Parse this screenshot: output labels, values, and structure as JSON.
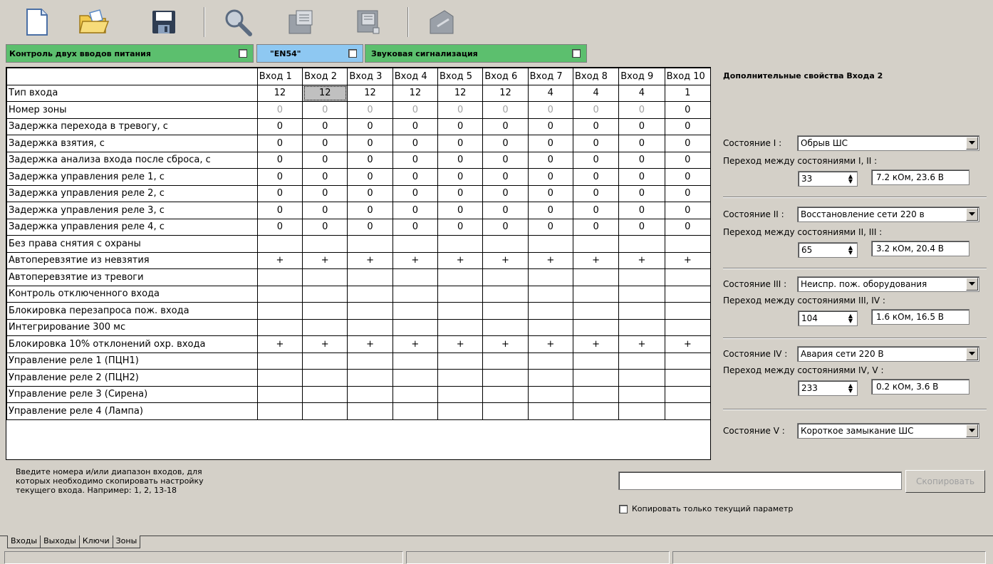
{
  "toolbar": {
    "buttons": [
      {
        "icon": "new-document-icon"
      },
      {
        "icon": "open-folder-icon"
      },
      {
        "icon": "save-icon"
      },
      {
        "icon": "search-icon"
      },
      {
        "icon": "read-device-icon"
      },
      {
        "icon": "write-device-icon"
      },
      {
        "icon": "firmware-icon"
      }
    ]
  },
  "flags": {
    "dual_power": "Контроль двух вводов питания",
    "en54": "\"EN54\"",
    "sound": "Звуковая сигнализация",
    "colors": {
      "dual_power": "#5cbf6e",
      "en54": "#8ec8f2",
      "sound": "#5cbf6e"
    }
  },
  "grid": {
    "columns": [
      "Вход 1",
      "Вход 2",
      "Вход 3",
      "Вход 4",
      "Вход 5",
      "Вход 6",
      "Вход 7",
      "Вход 8",
      "Вход 9",
      "Вход 10"
    ],
    "rows": [
      {
        "label": "Тип входа",
        "values": [
          "12",
          "12",
          "12",
          "12",
          "12",
          "12",
          "4",
          "4",
          "4",
          "1"
        ]
      },
      {
        "label": "Номер зоны",
        "values": [
          "0",
          "0",
          "0",
          "0",
          "0",
          "0",
          "0",
          "0",
          "0",
          "0"
        ]
      },
      {
        "label": "Задержка перехода в тревогу, с",
        "values": [
          "0",
          "0",
          "0",
          "0",
          "0",
          "0",
          "0",
          "0",
          "0",
          "0"
        ]
      },
      {
        "label": "Задержка взятия, с",
        "values": [
          "0",
          "0",
          "0",
          "0",
          "0",
          "0",
          "0",
          "0",
          "0",
          "0"
        ]
      },
      {
        "label": "Задержка анализа входа после сброса, с",
        "values": [
          "0",
          "0",
          "0",
          "0",
          "0",
          "0",
          "0",
          "0",
          "0",
          "0"
        ]
      },
      {
        "label": "Задержка управления реле 1, с",
        "values": [
          "0",
          "0",
          "0",
          "0",
          "0",
          "0",
          "0",
          "0",
          "0",
          "0"
        ]
      },
      {
        "label": "Задержка управления реле 2, с",
        "values": [
          "0",
          "0",
          "0",
          "0",
          "0",
          "0",
          "0",
          "0",
          "0",
          "0"
        ]
      },
      {
        "label": "Задержка управления реле 3, с",
        "values": [
          "0",
          "0",
          "0",
          "0",
          "0",
          "0",
          "0",
          "0",
          "0",
          "0"
        ]
      },
      {
        "label": "Задержка управления реле 4, с",
        "values": [
          "0",
          "0",
          "0",
          "0",
          "0",
          "0",
          "0",
          "0",
          "0",
          "0"
        ]
      },
      {
        "label": "Без права снятия с охраны",
        "values": [
          "",
          "",
          "",
          "",
          "",
          "",
          "",
          "",
          "",
          ""
        ]
      },
      {
        "label": "Автоперевзятие из невзятия",
        "values": [
          "+",
          "+",
          "+",
          "+",
          "+",
          "+",
          "+",
          "+",
          "+",
          "+"
        ]
      },
      {
        "label": "Автоперевзятие из тревоги",
        "values": [
          "",
          "",
          "",
          "",
          "",
          "",
          "",
          "",
          "",
          ""
        ]
      },
      {
        "label": "Контроль отключенного входа",
        "values": [
          "",
          "",
          "",
          "",
          "",
          "",
          "",
          "",
          "",
          ""
        ]
      },
      {
        "label": "Блокировка перезапроса пож. входа",
        "values": [
          "",
          "",
          "",
          "",
          "",
          "",
          "",
          "",
          "",
          ""
        ]
      },
      {
        "label": "Интегрирование 300 мс",
        "values": [
          "",
          "",
          "",
          "",
          "",
          "",
          "",
          "",
          "",
          ""
        ]
      },
      {
        "label": "Блокировка 10% отклонений охр. входа",
        "values": [
          "+",
          "+",
          "+",
          "+",
          "+",
          "+",
          "+",
          "+",
          "+",
          "+"
        ]
      },
      {
        "label": "Управление реле 1 (ПЦН1)",
        "values": [
          "",
          "",
          "",
          "",
          "",
          "",
          "",
          "",
          "",
          ""
        ]
      },
      {
        "label": "Управление реле 2 (ПЦН2)",
        "values": [
          "",
          "",
          "",
          "",
          "",
          "",
          "",
          "",
          "",
          ""
        ]
      },
      {
        "label": "Управление реле 3 (Сирена)",
        "values": [
          "",
          "",
          "",
          "",
          "",
          "",
          "",
          "",
          "",
          ""
        ]
      },
      {
        "label": "Управление реле 4 (Лампа)",
        "values": [
          "",
          "",
          "",
          "",
          "",
          "",
          "",
          "",
          "",
          ""
        ]
      }
    ]
  },
  "side": {
    "title": "Дополнительные свойства Входа 2",
    "states": [
      {
        "label": "Состояние I :",
        "value": "Обрыв ШС",
        "transition": "Переход между состояниями I, II :",
        "threshold": "33",
        "resistance": "7.2 кОм, 23.6 В"
      },
      {
        "label": "Состояние II :",
        "value": "Восстановление сети 220 в",
        "transition": "Переход между состояниями II, III :",
        "threshold": "65",
        "resistance": "3.2 кОм, 20.4 В"
      },
      {
        "label": "Состояние III :",
        "value": "Неиспр. пож. оборудования",
        "transition": "Переход между состояниями III, IV :",
        "threshold": "104",
        "resistance": "1.6 кОм, 16.5 В"
      },
      {
        "label": "Состояние IV :",
        "value": "Авария сети 220 В",
        "transition": "Переход между состояниями IV, V :",
        "threshold": "233",
        "resistance": "0.2 кОм,  3.6 В"
      },
      {
        "label": "Состояние V :",
        "value": "Короткое замыкание ШС"
      }
    ]
  },
  "copy": {
    "hint": "Введите номера и/или диапазон входов, для которых необходимо скопировать настройку текущего входа. Например: 1, 2, 13-18",
    "input_value": "",
    "button": "Скопировать",
    "only_current": "Копировать только текущий параметр"
  },
  "tabs": [
    "Входы",
    "Выходы",
    "Ключи",
    "Зоны"
  ],
  "statusbar": [
    "",
    "",
    ""
  ]
}
